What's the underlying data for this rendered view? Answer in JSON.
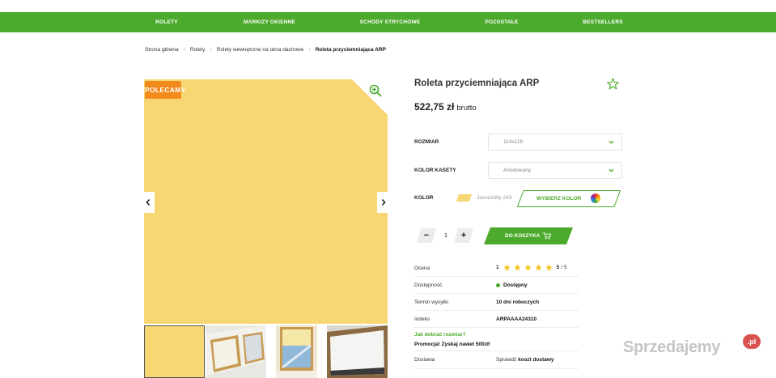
{
  "nav": {
    "items": [
      "ROLETY",
      "MARKIZY OKIENNE",
      "SCHODY STRYCHOWE",
      "POZOSTAŁE",
      "BESTSELLERS"
    ]
  },
  "breadcrumb": {
    "items": [
      "Strona główna",
      "Rolety",
      "Rolety wewnętrzne na okna dachowe"
    ],
    "current": "Roleta przyciemniająca ARP",
    "separator": "›"
  },
  "gallery": {
    "badge": "POLECAMY",
    "main_color": "#f7d774",
    "icons": {
      "zoom": "zoom-in-icon",
      "prev": "chevron-left-icon",
      "next": "chevron-right-icon"
    }
  },
  "product": {
    "title": "Roleta przyciemniająca ARP",
    "price": "522,75 zł",
    "price_suffix": "brutto",
    "favorite_icon": "star-outline-icon"
  },
  "options": {
    "size": {
      "label": "ROZMIAR",
      "value": "114x118"
    },
    "cassette": {
      "label": "KOLOR KASETY",
      "value": "Anodowany"
    },
    "color": {
      "label": "KOLOR",
      "value": "Jasnożółty 243",
      "swatch": "#f7d774",
      "button": "WYBIERZ KOLOR"
    }
  },
  "cart": {
    "minus": "−",
    "quantity": "1",
    "plus": "+",
    "button": "DO KOSZYKA"
  },
  "info": {
    "rating": {
      "label": "Ocena",
      "count": "1",
      "stars": 5,
      "score": "5",
      "out_of": "/ 5"
    },
    "availability": {
      "label": "Dostępność",
      "value": "Dostępny"
    },
    "shipping_time": {
      "label": "Termin wysyłki",
      "value": "10 dni roboczych"
    },
    "index": {
      "label": "Indeks",
      "value": "ARPAAAA24310"
    },
    "size_link": "Jak dobrać rozmiar?",
    "promo": "Promocja! Zyskaj nawet 500zł!",
    "delivery": {
      "label": "Dostawa",
      "prefix": "Sprawdź",
      "link": "koszt dostawy"
    }
  },
  "watermark": {
    "text": "Sprzedajemy",
    "badge": ".pl"
  },
  "colors": {
    "brand_green": "#4caa2c",
    "badge_orange": "#f28a1c",
    "star_yellow": "#f5c518"
  }
}
